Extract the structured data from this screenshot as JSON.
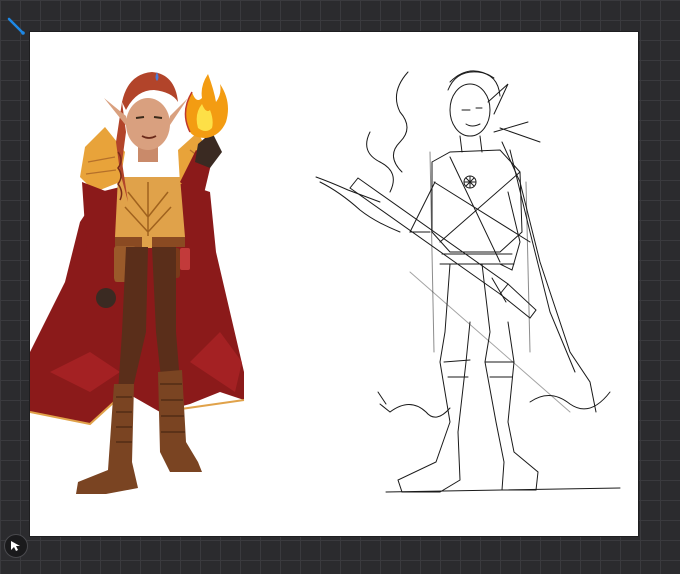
{
  "app": {
    "background_color": "#2b2b2e",
    "grid_color": "#3a3a3e",
    "accent_color": "#1e88e5"
  },
  "toolbar": {
    "active_tool_icon": "brush-cursor-icon",
    "modify_icon": "arrow-cursor-icon"
  },
  "canvas": {
    "background_color": "#ffffff",
    "artworks": [
      {
        "kind": "colored illustration",
        "palette": [
          "#8b1a1a",
          "#b5262a",
          "#e0a24a",
          "#6b3a1f",
          "#c9622f",
          "#f39c12"
        ]
      },
      {
        "kind": "pencil sketch",
        "palette": [
          "#1a1a1a"
        ]
      }
    ]
  }
}
